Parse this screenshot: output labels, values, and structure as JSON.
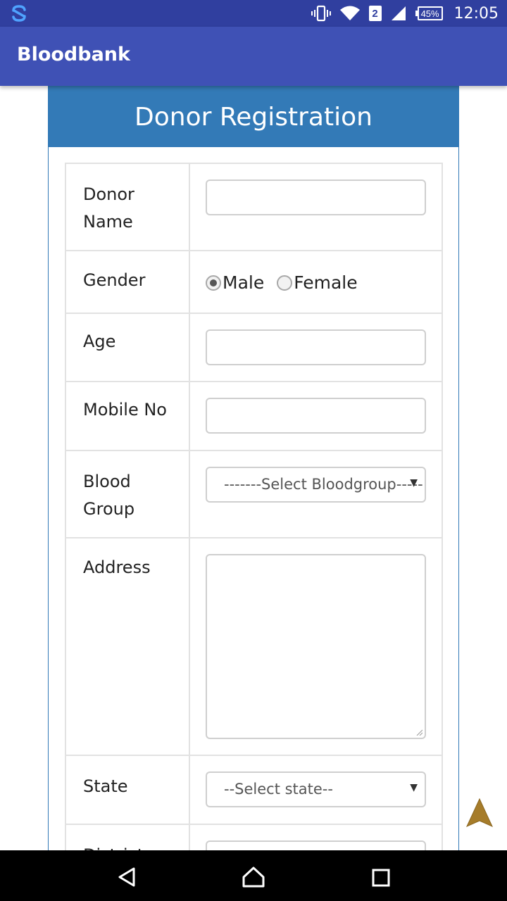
{
  "status_bar": {
    "time": "12:05",
    "battery": "45%",
    "sim": "2",
    "icons": [
      "sync-icon",
      "vibrate-icon",
      "wifi-icon",
      "sim-icon",
      "signal-icon",
      "battery-icon"
    ]
  },
  "app_bar": {
    "title": "Bloodbank"
  },
  "form": {
    "heading": "Donor Registration",
    "donor_name_label": "Donor Name",
    "gender_label": "Gender",
    "gender_options": {
      "male": "Male",
      "female": "Female",
      "selected": "Male"
    },
    "age_label": "Age",
    "mobile_label": "Mobile No",
    "blood_group_label": "Blood Group",
    "blood_group_value": "-------Select Bloodgroup-----",
    "address_label": "Address",
    "state_label": "State",
    "state_value": "--Select state--",
    "district_label": "District"
  },
  "nav_bar": {
    "icons": [
      "back-icon",
      "home-icon",
      "recents-icon"
    ]
  },
  "colors": {
    "status_bar": "#303f9f",
    "app_bar": "#3f51b5",
    "panel_heading": "#337ab7",
    "fab": "#a67c2a"
  }
}
